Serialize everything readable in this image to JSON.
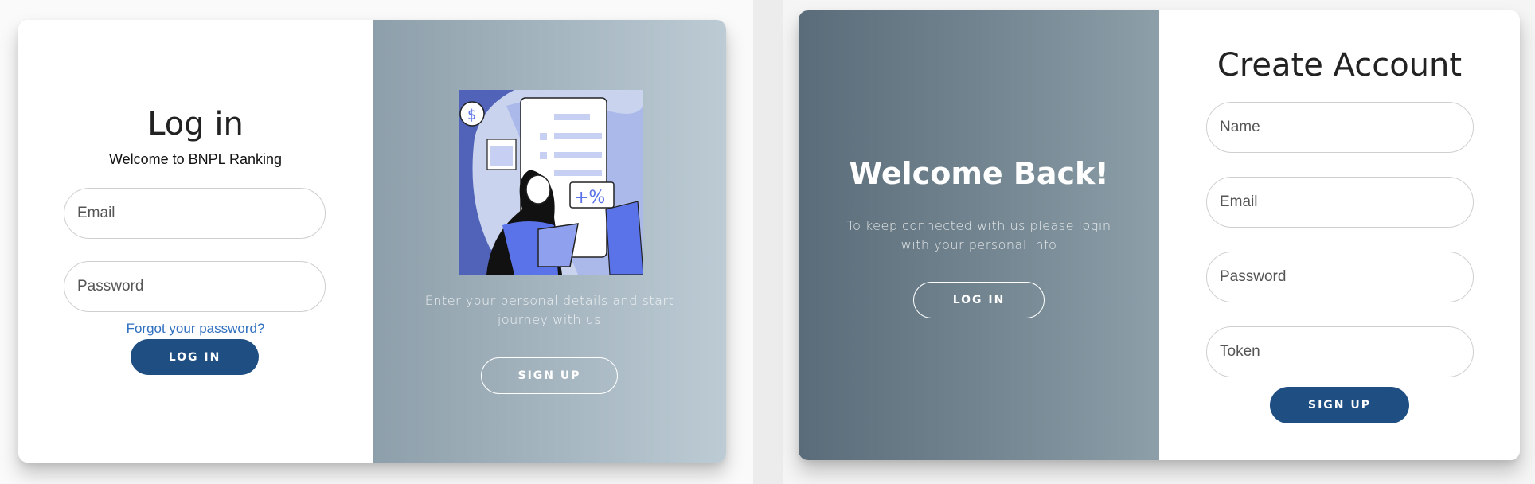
{
  "login_panel": {
    "title": "Log in",
    "subtitle": "Welcome to BNPL Ranking",
    "email_placeholder": "Email",
    "password_placeholder": "Password",
    "forgot_link": "Forgot your password?",
    "login_button": "LOG IN"
  },
  "login_overlay": {
    "illustration_icon": "woman-with-tablet-and-invoice-illustration",
    "message": "Enter your personal details and start journey with us",
    "signup_button": "SIGN UP"
  },
  "welcome_overlay": {
    "title": "Welcome Back!",
    "message": "To keep connected with us please login with your personal info",
    "login_button": "LOG IN"
  },
  "signup_panel": {
    "title": "Create Account",
    "name_placeholder": "Name",
    "email_placeholder": "Email",
    "password_placeholder": "Password",
    "token_placeholder": "Token",
    "signup_button": "SIGN UP"
  },
  "colors": {
    "primary_button": "#1f4e82",
    "link": "#2f6fbf",
    "illustration_accent": "#5b73e8"
  }
}
